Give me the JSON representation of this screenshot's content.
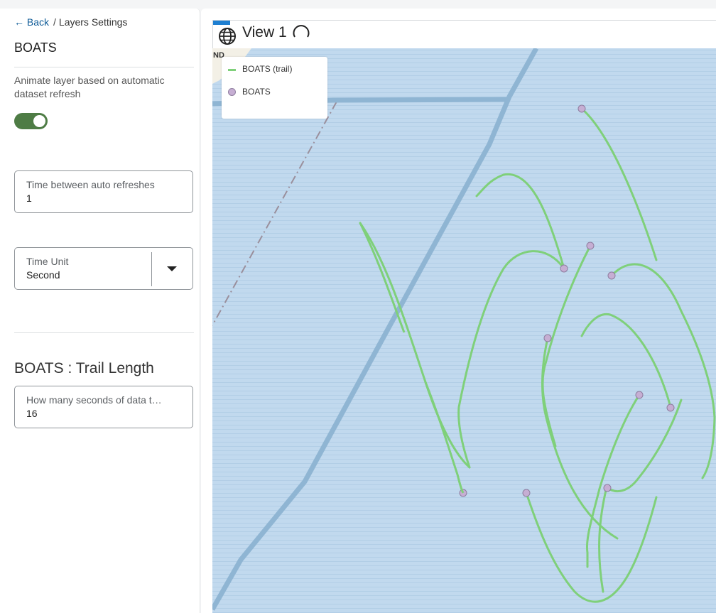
{
  "breadcrumb": {
    "back_label": "← Back",
    "separator": "/",
    "current": "Layers Settings"
  },
  "layer": {
    "name": "BOATS"
  },
  "animate": {
    "label": "Animate layer based on automatic dataset refresh",
    "enabled": true
  },
  "refresh_field": {
    "label": "Time between auto refreshes",
    "value": "1"
  },
  "time_unit": {
    "label": "Time Unit",
    "value": "Second"
  },
  "trail": {
    "section_title": "BOATS : Trail Length",
    "field_label": "How many seconds of data t…",
    "field_value": "16"
  },
  "view": {
    "title": "View 1"
  },
  "legend": {
    "items": [
      {
        "label": "BOATS (trail)",
        "symbol": "line",
        "color": "#7fd07a"
      },
      {
        "label": "BOATS",
        "symbol": "circle",
        "color": "#c6aed3"
      }
    ]
  },
  "map_corner_label": "ND",
  "colors": {
    "accent": "#0d5a97",
    "toggle_on": "#4e7c45",
    "water": "#c1d9ee",
    "road": "#8fb5d3",
    "trail": "#7fd07a",
    "boat": "#c6aed3"
  },
  "icons": {
    "view": "globe-icon",
    "loading": "spinner-icon",
    "dropdown": "caret-down-icon"
  }
}
